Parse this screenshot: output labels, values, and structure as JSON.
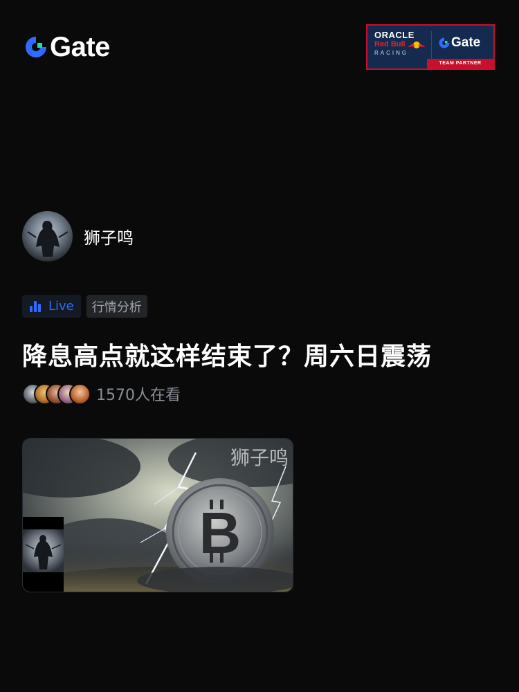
{
  "header": {
    "brand": "Gate",
    "partner": {
      "oracle": "ORACLE",
      "redbull": "Red Bull",
      "racing": "RACING",
      "brand": "Gate",
      "team_partner": "TEAM PARTNER"
    }
  },
  "host": {
    "name": "狮子鸣"
  },
  "tags": {
    "live": "Live",
    "category": "行情分析"
  },
  "stream": {
    "title": "降息高点就这样结束了？周六日震荡",
    "viewer_count": "1570人在看",
    "watermark": "狮子鸣"
  },
  "colors": {
    "background": "#0a0a0a",
    "accent_blue": "#2f6bff",
    "gate_green": "#17e6a1",
    "partner_navy": "#142a4e",
    "partner_red": "#c8102e"
  },
  "icons": {
    "brand": "gate-logo-icon",
    "live": "live-bars-icon"
  }
}
